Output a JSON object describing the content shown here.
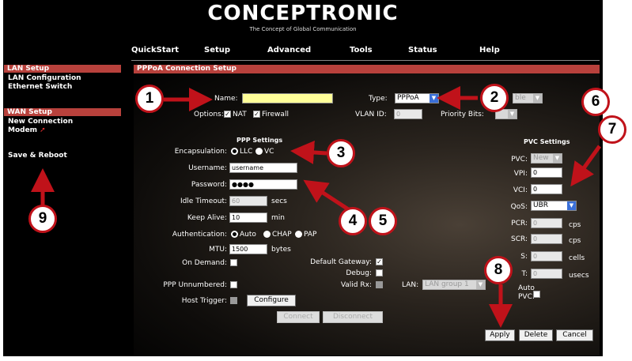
{
  "header": {
    "logo": "CONCEPTRONIC",
    "tagline": "The Concept of Global Communication"
  },
  "topnav": [
    "QuickStart",
    "Setup",
    "Advanced",
    "Tools",
    "Status",
    "Help"
  ],
  "sidebar": {
    "lan_title": "LAN Setup",
    "lan_items": [
      "LAN Configuration",
      "Ethernet Switch"
    ],
    "wan_title": "WAN Setup",
    "wan_items": [
      "New Connection",
      "Modem"
    ],
    "save": "Save & Reboot"
  },
  "main": {
    "title": "PPPoA Connection Setup",
    "name_label": "Name:",
    "name_value": "",
    "type_label": "Type:",
    "type_value": "PPPoA",
    "type_right": "ble",
    "options_label": "Options:",
    "nat_label": "NAT",
    "firewall_label": "Firewall",
    "vlan_label": "VLAN ID:",
    "vlan_value": "0",
    "priority_label": "Priority Bits:",
    "ppp": {
      "title": "PPP Settings",
      "encap_label": "Encapsulation:",
      "llc": "LLC",
      "vc": "VC",
      "username_label": "Username:",
      "username_value": "username",
      "password_label": "Password:",
      "password_value": "●●●●",
      "idle_label": "Idle Timeout:",
      "idle_value": "60",
      "idle_unit": "secs",
      "keepalive_label": "Keep Alive:",
      "keepalive_value": "10",
      "keepalive_unit": "min",
      "auth_label": "Authentication:",
      "auth_auto": "Auto",
      "auth_chap": "CHAP",
      "auth_pap": "PAP",
      "mtu_label": "MTU:",
      "mtu_value": "1500",
      "mtu_unit": "bytes",
      "ondemand_label": "On Demand:",
      "default_gw_label": "Default Gateway:",
      "debug_label": "Debug:",
      "unnumbered_label": "PPP Unnumbered:",
      "validrx_label": "Valid Rx:",
      "lan_label": "LAN:",
      "lan_value": "LAN group 1",
      "hosttrigger_label": "Host Trigger:",
      "configure_btn": "Configure",
      "connect_btn": "Connect",
      "disconnect_btn": "Disconnect"
    },
    "pvc": {
      "title": "PVC Settings",
      "pvc_label": "PVC:",
      "pvc_value": "New",
      "vpi_label": "VPI:",
      "vpi_value": "0",
      "vci_label": "VCI:",
      "vci_value": "0",
      "qos_label": "QoS:",
      "qos_value": "UBR",
      "pcr_label": "PCR:",
      "pcr_value": "0",
      "pcr_unit": "cps",
      "scr_label": "SCR:",
      "scr_value": "0",
      "scr_unit": "cps",
      "mbs_label": "S:",
      "mbs_value": "0",
      "mbs_unit": "cells",
      "cdvt_label": "T:",
      "cdvt_value": "0",
      "cdvt_unit": "usecs",
      "autopvc_label": "Auto PVC:"
    },
    "buttons": {
      "apply": "Apply",
      "delete": "Delete",
      "cancel": "Cancel"
    }
  },
  "callouts": [
    "1",
    "2",
    "3",
    "4",
    "5",
    "6",
    "7",
    "8",
    "9"
  ],
  "colors": {
    "section_bar": "#b8413c",
    "callout_border": "#c0121a",
    "name_field": "#ffff99",
    "select_arrow": "#3a6fd8"
  }
}
